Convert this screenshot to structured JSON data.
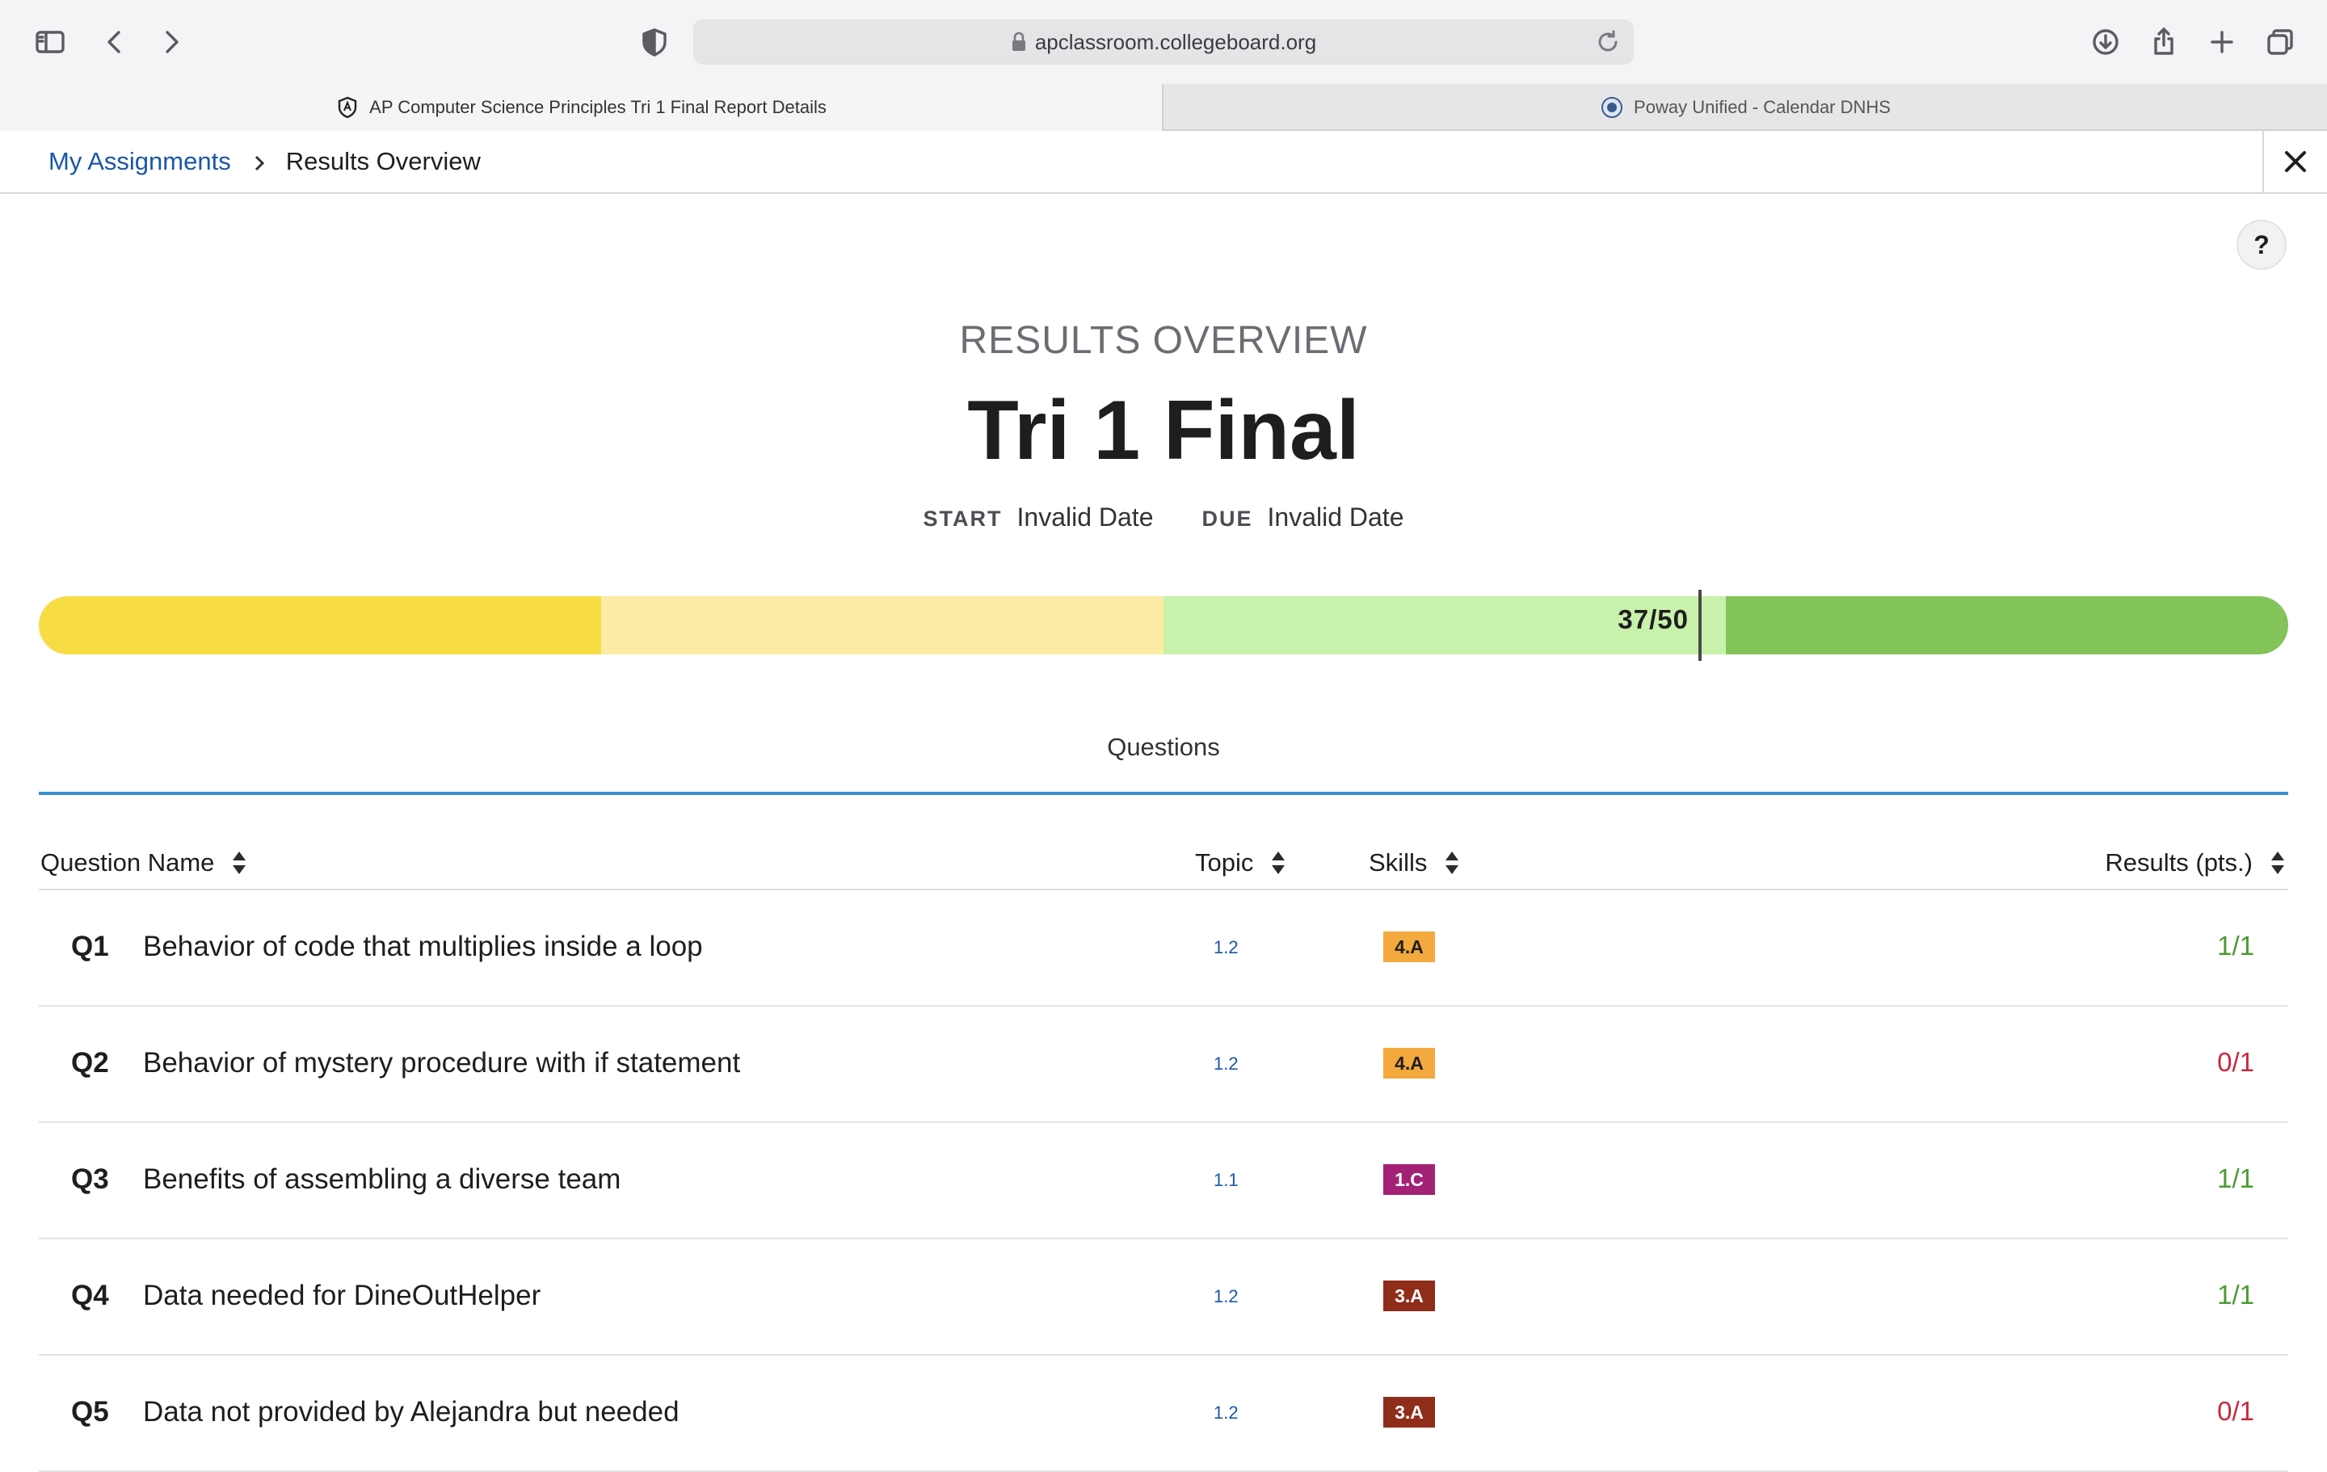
{
  "browser": {
    "url": "apclassroom.collegeboard.org",
    "tabs": [
      {
        "label": "AP Computer Science Principles Tri 1 Final Report Details",
        "active": true
      },
      {
        "label": "Poway Unified - Calendar DNHS",
        "active": false
      }
    ]
  },
  "header": {
    "breadcrumb_link": "My Assignments",
    "breadcrumb_current": "Results Overview",
    "help_label": "?"
  },
  "overview": {
    "label": "RESULTS OVERVIEW",
    "title": "Tri 1 Final",
    "start_key": "START",
    "start_value": "Invalid Date",
    "due_key": "DUE",
    "due_value": "Invalid Date",
    "score_text": "37/50",
    "score": 37,
    "max_score": 50,
    "score_fraction": 0.74,
    "bar_colors": [
      "#f8dc44",
      "#fbeba4",
      "#c8f1ac",
      "#82c35a"
    ]
  },
  "tabs": {
    "questions": "Questions"
  },
  "table": {
    "col_question": "Question Name",
    "col_topic": "Topic",
    "col_skills": "Skills",
    "col_results": "Results (pts.)",
    "rows": [
      {
        "num": "Q1",
        "name": "Behavior of code that multiplies inside a loop",
        "topic": "1.2",
        "skill": "4.A",
        "skill_bg": "#f3a93e",
        "skill_fg": "#1e1e1e",
        "result": "1/1",
        "result_color": "#4a9b2f"
      },
      {
        "num": "Q2",
        "name": "Behavior of mystery procedure with if statement",
        "topic": "1.2",
        "skill": "4.A",
        "skill_bg": "#f3a93e",
        "skill_fg": "#1e1e1e",
        "result": "0/1",
        "result_color": "#c8283d"
      },
      {
        "num": "Q3",
        "name": "Benefits of assembling a diverse team",
        "topic": "1.1",
        "skill": "1.C",
        "skill_bg": "#a32275",
        "skill_fg": "#ffffff",
        "result": "1/1",
        "result_color": "#4a9b2f"
      },
      {
        "num": "Q4",
        "name": "Data needed for DineOutHelper",
        "topic": "1.2",
        "skill": "3.A",
        "skill_bg": "#8f2d1a",
        "skill_fg": "#ffffff",
        "result": "1/1",
        "result_color": "#4a9b2f"
      },
      {
        "num": "Q5",
        "name": "Data not provided by Alejandra but needed",
        "topic": "1.2",
        "skill": "3.A",
        "skill_bg": "#8f2d1a",
        "skill_fg": "#ffffff",
        "result": "0/1",
        "result_color": "#c8283d"
      }
    ]
  }
}
